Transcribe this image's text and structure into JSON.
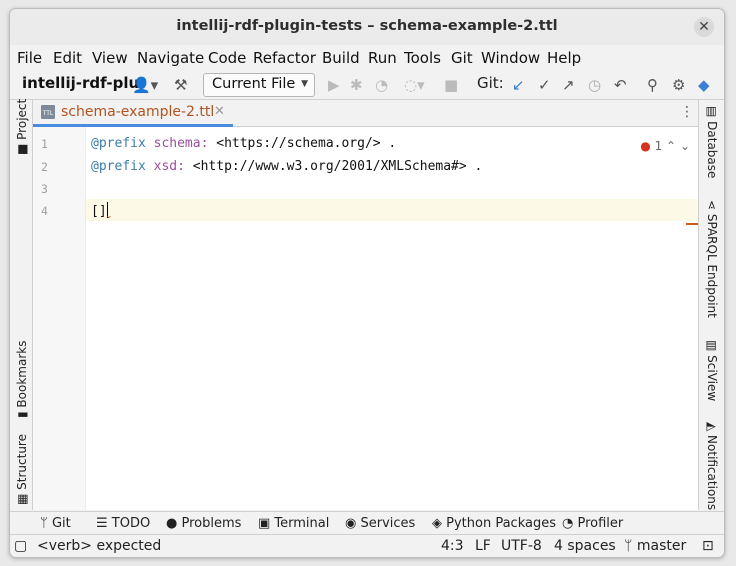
{
  "window": {
    "title": "intellij-rdf-plugin-tests – schema-example-2.ttl"
  },
  "menu": [
    "File",
    "Edit",
    "View",
    "Navigate",
    "Code",
    "Refactor",
    "Build",
    "Run",
    "Tools",
    "Git",
    "Window",
    "Help"
  ],
  "toolbar": {
    "project": "intellij-rdf-plu",
    "run_config": "Current File",
    "git_label": "Git:"
  },
  "left_tools": [
    "Project",
    "Bookmarks",
    "Structure"
  ],
  "right_tools": [
    "Database",
    "SPARQL Endpoint",
    "SciView",
    "Notifications"
  ],
  "tab": {
    "file_name": "schema-example-2.ttl",
    "file_type": "TTL"
  },
  "editor": {
    "line_numbers": [
      "1",
      "2",
      "3",
      "4"
    ],
    "lines": [
      {
        "kw": "@prefix",
        "prefix": "schema:",
        "rest": " <https://schema.org/> ."
      },
      {
        "kw": "@prefix",
        "prefix": "xsd:",
        "rest": " <http://www.w3.org/2001/XMLSchema#> ."
      },
      {
        "text": ""
      },
      {
        "text": "[]"
      }
    ],
    "problems_count": "1"
  },
  "bottom_tools": [
    "Git",
    "TODO",
    "Problems",
    "Terminal",
    "Services",
    "Python Packages",
    "Profiler"
  ],
  "status": {
    "message": "<verb> expected",
    "position": "4:3",
    "line_sep": "LF",
    "encoding": "UTF-8",
    "indent": "4 spaces",
    "branch": "master"
  },
  "colors": {
    "accent": "#4a8be0",
    "error": "#d7321e",
    "file_tab": "#b2521e"
  }
}
